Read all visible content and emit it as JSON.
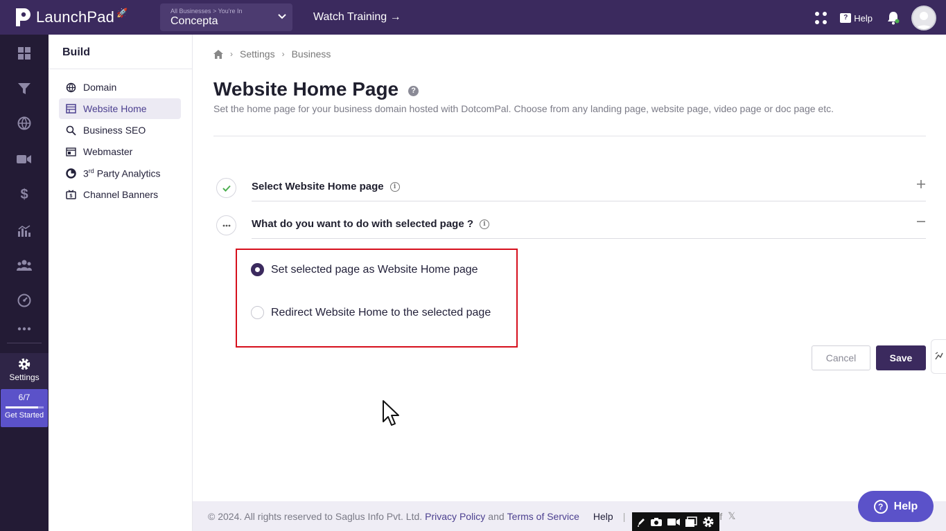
{
  "app": {
    "name": "LaunchPad",
    "business_switcher": {
      "caption": "All Businesses > You're In",
      "value": "Concepta"
    },
    "watch_training": "Watch Training →",
    "help_label": "Help"
  },
  "rail": {
    "items": [
      "dashboard-icon",
      "funnel-icon",
      "globe-icon",
      "video-icon",
      "dollar-icon",
      "analytics-icon",
      "users-icon",
      "speedometer-icon",
      "more-icon"
    ],
    "settings_label": "Settings",
    "get_started": {
      "progress_text": "6/7",
      "progress_fraction": 0.857,
      "label": "Get Started"
    }
  },
  "subnav": {
    "heading": "Build",
    "items": [
      {
        "label": "Domain",
        "icon": "globe-icon",
        "active": false
      },
      {
        "label": "Website Home",
        "icon": "layout-icon",
        "active": true
      },
      {
        "label": "Business SEO",
        "icon": "seo-search-icon",
        "active": false
      },
      {
        "label": "Webmaster",
        "icon": "webmaster-icon",
        "active": false
      },
      {
        "label_main": "3",
        "label_sup": "rd",
        "label_rest": " Party Analytics",
        "icon": "pie-chart-icon",
        "active": false
      },
      {
        "label": "Channel Banners",
        "icon": "banner-icon",
        "active": false
      }
    ]
  },
  "breadcrumb": {
    "items": [
      "Settings",
      "Business"
    ]
  },
  "page": {
    "title": "Website Home Page",
    "description": "Set the home page for your business domain hosted with DotcomPal. Choose from any landing page, website page, video page or doc page etc."
  },
  "steps": [
    {
      "label": "Select Website Home page",
      "status": "complete",
      "toggle": "+"
    },
    {
      "label": "What do you want to do with selected page ?",
      "status": "in-progress",
      "toggle": "−"
    }
  ],
  "options": [
    {
      "label": "Set selected page as Website Home page",
      "checked": true
    },
    {
      "label": "Redirect Website Home to the selected page",
      "checked": false
    }
  ],
  "actions": {
    "cancel": "Cancel",
    "save": "Save"
  },
  "footer": {
    "copyright": "©  2024. All rights reserved to Saglus Info Pvt. Ltd.",
    "privacy": "Privacy Policy",
    "and": "and",
    "terms": "Terms of Service",
    "help": "Help",
    "separator": "|"
  },
  "help_fab": "Help",
  "colors": {
    "brand": "#3b2a5e",
    "accent": "#5b52c9",
    "highlight": "#d60f1c",
    "success": "#4caf50"
  }
}
